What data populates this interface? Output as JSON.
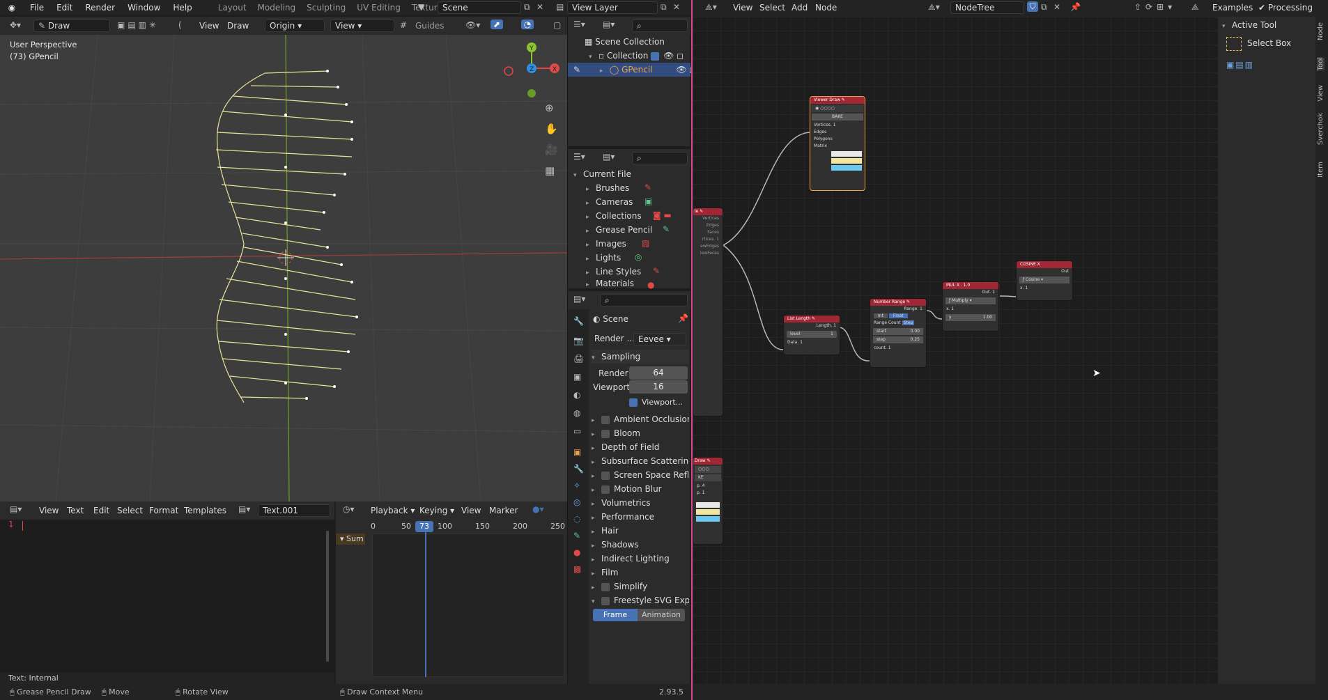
{
  "topbar": {
    "menus": [
      "File",
      "Edit",
      "Render",
      "Window",
      "Help"
    ],
    "workspaces": [
      "Layout",
      "Modeling",
      "Sculpting",
      "UV Editing",
      "Texture Paint"
    ],
    "scene": "Scene",
    "view_layer": "View Layer"
  },
  "viewport": {
    "mode": "Draw",
    "origin": "Origin",
    "view_menu": "View",
    "header_view": "View",
    "header_draw": "Draw",
    "guides": "Guides",
    "overlay_line1": "User Perspective",
    "overlay_line2": "(73) GPencil"
  },
  "outliner": {
    "items": [
      "Scene Collection",
      "Collection",
      "GPencil"
    ]
  },
  "blendfile": {
    "root": "Current File",
    "items": [
      "Brushes",
      "Cameras",
      "Collections",
      "Grease Pencil",
      "Images",
      "Lights",
      "Line Styles",
      "Materials"
    ]
  },
  "properties": {
    "scene": "Scene",
    "render_engine_label": "Render ...",
    "render_engine": "Eevee",
    "sampling": "Sampling",
    "render_label": "Render",
    "render_value": "64",
    "viewport_label": "Viewport",
    "viewport_value": "16",
    "viewport_denoise": "Viewport...",
    "sections": [
      "Ambient Occlusion",
      "Bloom",
      "Depth of Field",
      "Subsurface Scattering",
      "Screen Space Refle",
      "Motion Blur",
      "Volumetrics",
      "Performance",
      "Hair",
      "Shadows",
      "Indirect Lighting",
      "Film",
      "Simplify",
      "Freestyle SVG Expo"
    ],
    "frame_btn": "Frame",
    "animation_btn": "Animation"
  },
  "text_editor": {
    "menus": [
      "View",
      "Text",
      "Edit",
      "Select",
      "Format",
      "Templates"
    ],
    "name": "Text.001",
    "line_no": "1",
    "footer": "Text: Internal"
  },
  "timeline": {
    "menus": [
      "Playback",
      "Keying",
      "View",
      "Marker"
    ],
    "ticks": [
      "0",
      "50",
      "100",
      "150",
      "200",
      "250"
    ],
    "current": "73",
    "summary": "Sum"
  },
  "node_editor": {
    "menus": [
      "View",
      "Select",
      "Add",
      "Node"
    ],
    "tree": "NodeTree",
    "examples": "Examples",
    "processing": "Processing"
  },
  "nodes": {
    "viewer": "Viewer Draw",
    "bake": "BAKE",
    "list_length": "List Length",
    "length": "Length. 1",
    "level": "level",
    "level_val": "1",
    "data": "Data. 1",
    "number_range": "Number Range",
    "range": "Range. 1",
    "int": "Int",
    "float": "Float",
    "range_count": "Range Count",
    "step": "Step",
    "start": "start",
    "start_val": "0.00",
    "step_lbl": "step",
    "step_val": "0.25",
    "count": "count. 1",
    "mul": "MUL X . 1.0",
    "out1": "Out. 1",
    "multiply": "Multiply",
    "x1": "x. 1",
    "y": "y",
    "y_val": "1.00",
    "cosine": "COSINE X",
    "out": "Out",
    "cos": "Cosine",
    "cx": "x. 1"
  },
  "sidebar": {
    "title": "Active Tool",
    "tool": "Select Box",
    "tabs": [
      "Node",
      "Tool",
      "View",
      "Sverchok",
      "Item"
    ]
  },
  "status": {
    "item1": "Grease Pencil Draw",
    "item2": "Move",
    "item3": "Rotate View",
    "item4": "Draw Context Menu",
    "version": "2.93.5"
  }
}
